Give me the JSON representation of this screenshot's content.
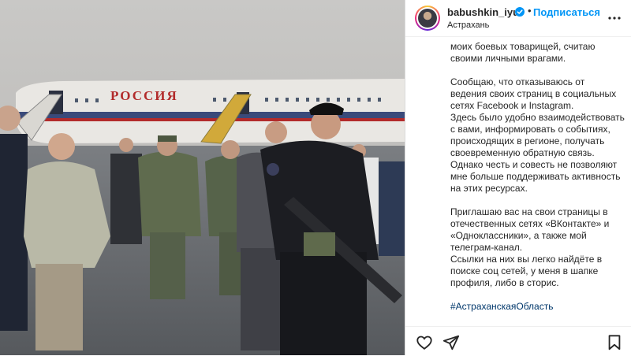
{
  "post": {
    "username": "babushkin_iyu",
    "follow_label": "Подписаться",
    "separator": "•",
    "location": "Астрахань",
    "caption": {
      "p1": "моих боевых товарищей, считаю\nсвоими личными врагами.",
      "p2": "Сообщаю, что отказываюсь от\nведения своих страниц в социальных\nсетях Facebook и Instagram.\nЗдесь было удобно взаимодействовать\nс вами, информировать о событиях,\nпроисходящих в регионе, получать\nсвоевременную обратную связь.\nОднако честь и совесть не позволяют\nмне больше поддерживать активность\nна этих ресурсах.",
      "p3": "Приглашаю вас на свои страницы в\nотечественных сетях «ВКонтакте» и\n«Одноклассники», а также мой\nтелеграм-канал.\nСсылки на них вы легко найдёте в\nпоиске соц сетей, у меня в шапке\nпрофиля, либо в сторис.",
      "hashtag": "#АстраханскаяОбласть"
    }
  },
  "photo": {
    "plane_text": "РОССИЯ"
  },
  "icons": {
    "verified": "verified-badge-icon",
    "more": "more-options-icon",
    "like": "heart-icon",
    "share": "send-icon",
    "save": "bookmark-icon"
  },
  "colors": {
    "link": "#0095f6",
    "hashtag": "#00376b",
    "text": "#262626"
  }
}
